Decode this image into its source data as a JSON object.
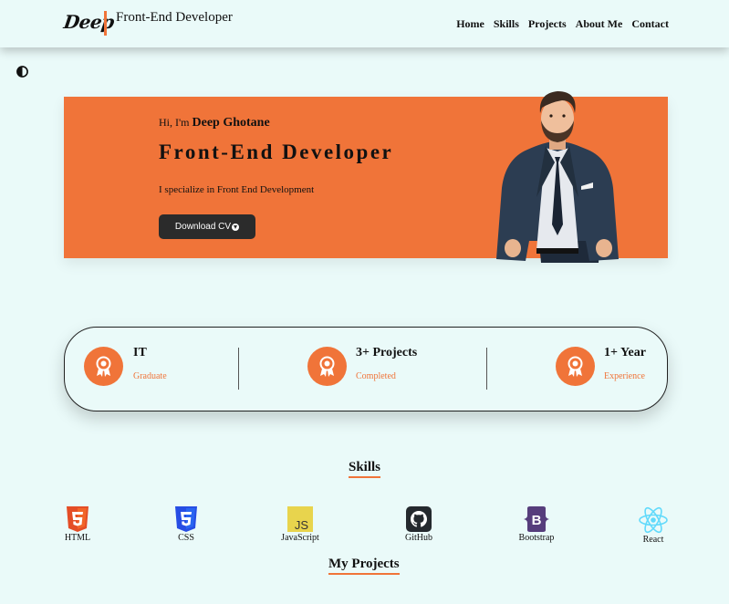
{
  "header": {
    "logo": "Deep",
    "title": "Front-End Developer",
    "nav": [
      "Home",
      "Skills",
      "Projects",
      "About Me",
      "Contact"
    ]
  },
  "hero": {
    "greeting": "Hi, I'm",
    "name": "Deep Ghotane",
    "role": "Front-End Developer",
    "description": "I specialize in Front End Development",
    "cv_button": "Download CV"
  },
  "stats": [
    {
      "title": "IT",
      "subtitle": "Graduate",
      "icon": "award-icon"
    },
    {
      "title": "3+ Projects",
      "subtitle": "Completed",
      "icon": "award-icon"
    },
    {
      "title": "1+ Year",
      "subtitle": "Experience",
      "icon": "award-icon"
    }
  ],
  "skills_heading": "Skills",
  "skills": [
    {
      "label": "HTML",
      "icon": "html5-icon"
    },
    {
      "label": "CSS",
      "icon": "css3-icon"
    },
    {
      "label": "JavaScript",
      "icon": "javascript-icon"
    },
    {
      "label": "GitHub",
      "icon": "github-icon"
    },
    {
      "label": "Bootstrap",
      "icon": "bootstrap-icon"
    },
    {
      "label": "React",
      "icon": "react-icon"
    }
  ],
  "projects_heading": "My Projects",
  "colors": {
    "accent": "#f07439",
    "background": "#eafaf9",
    "dark": "#2b2b2b"
  }
}
